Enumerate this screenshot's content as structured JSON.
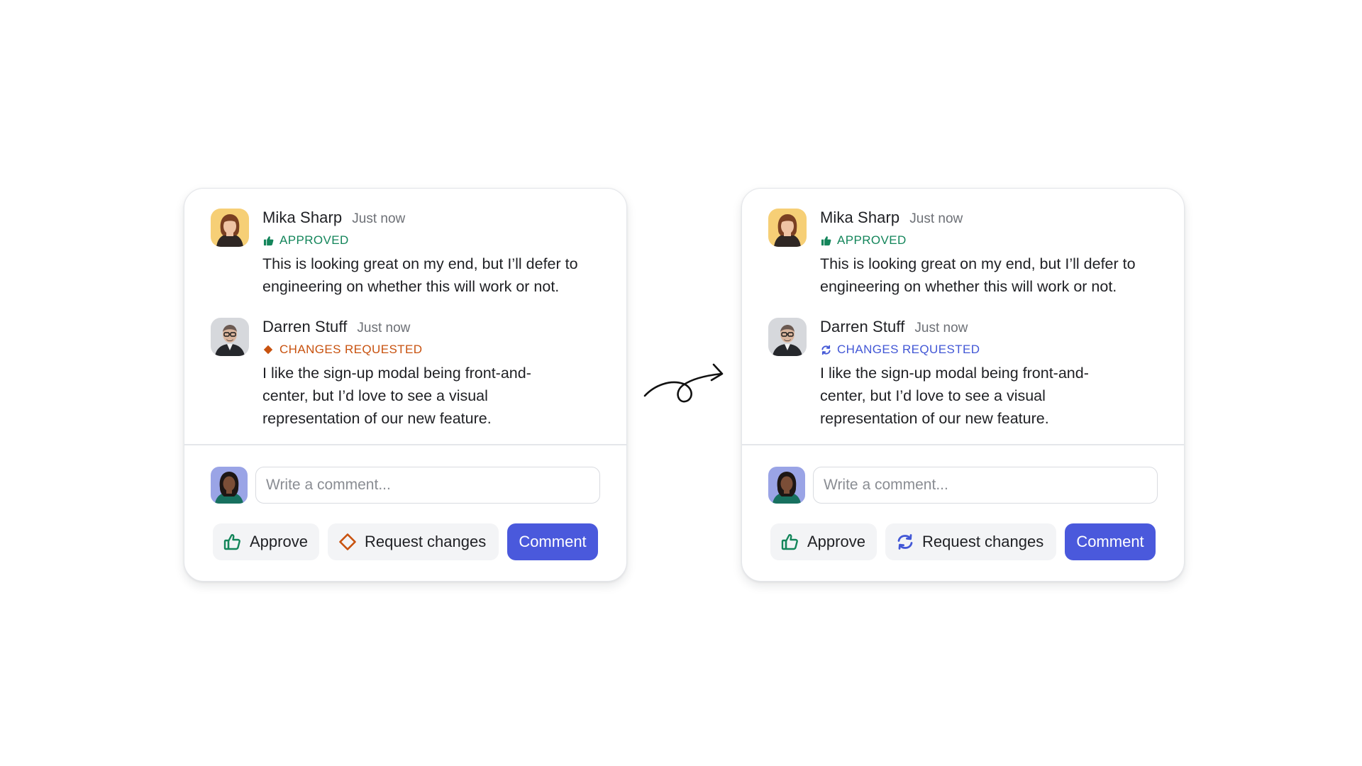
{
  "panels": [
    {
      "id": "before",
      "comments": [
        {
          "author": "Mika Sharp",
          "time": "Just now",
          "status": "APPROVED",
          "status_icon": "thumbs-up-icon",
          "status_color": "#13855a",
          "text_line1": "This is looking great on my end, but I’ll defer to",
          "text_line2": "engineering on whether this will work or not."
        },
        {
          "author": "Darren Stuff",
          "time": "Just now",
          "status": "CHANGES REQUESTED",
          "status_icon": "diamond-icon",
          "status_color": "#c8520f",
          "text_line1": "I like the sign-up modal being front-and-",
          "text_line2": "center, but I’d love to see a visual",
          "text_line3": "representation of our new feature."
        }
      ],
      "composer": {
        "placeholder": "Write a comment..."
      },
      "buttons": {
        "approve": "Approve",
        "approve_icon": "thumbs-up-outline-icon",
        "request": "Request changes",
        "request_icon": "diamond-outline-icon",
        "comment": "Comment"
      }
    },
    {
      "id": "after",
      "comments": [
        {
          "author": "Mika Sharp",
          "time": "Just now",
          "status": "APPROVED",
          "status_icon": "thumbs-up-icon",
          "status_color": "#13855a",
          "text_line1": "This is looking great on my end, but I’ll defer to",
          "text_line2": "engineering on whether this will work or not."
        },
        {
          "author": "Darren Stuff",
          "time": "Just now",
          "status": "CHANGES REQUESTED",
          "status_icon": "refresh-arrows-icon",
          "status_color": "#4257d6",
          "text_line1": "I like the sign-up modal being front-and-",
          "text_line2": "center, but I’d love to see a visual",
          "text_line3": "representation of our new feature."
        }
      ],
      "composer": {
        "placeholder": "Write a comment..."
      },
      "buttons": {
        "approve": "Approve",
        "approve_icon": "thumbs-up-outline-icon",
        "request": "Request changes",
        "request_icon": "refresh-arrows-icon",
        "comment": "Comment"
      }
    }
  ],
  "colors": {
    "approved_green": "#13855a",
    "changes_orange": "#c8520f",
    "changes_blue": "#4257d6",
    "comment_button": "#4a59dc"
  }
}
